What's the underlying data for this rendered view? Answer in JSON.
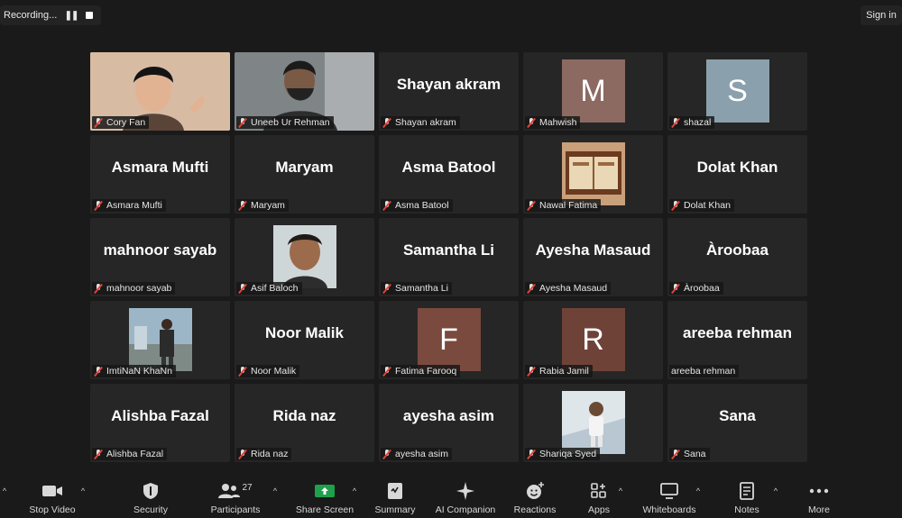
{
  "top_bar": {
    "recording_label": "Recording...",
    "pause_glyph": "❚❚",
    "sign_in_label": "Sign in"
  },
  "participants": [
    {
      "caption": "Cory Fan",
      "type": "video",
      "active": true
    },
    {
      "caption": "Uneeb Ur Rehman",
      "type": "video"
    },
    {
      "caption": "Shayan akram",
      "type": "name",
      "display": "Shayan akram"
    },
    {
      "caption": "Mahwish",
      "type": "avatar",
      "letter": "M",
      "color": "#8c6a62"
    },
    {
      "caption": "shazal",
      "type": "avatar",
      "letter": "S",
      "color": "#8aa0ac"
    },
    {
      "caption": "Asmara Mufti",
      "type": "name",
      "display": "Asmara Mufti"
    },
    {
      "caption": "Maryam",
      "type": "name",
      "display": "Maryam"
    },
    {
      "caption": "Asma Batool",
      "type": "name",
      "display": "Asma Batool"
    },
    {
      "caption": "Nawal Fatima",
      "type": "photo",
      "icon": "book-photo"
    },
    {
      "caption": "Dolat Khan",
      "type": "name",
      "display": "Dolat Khan"
    },
    {
      "caption": "mahnoor sayab",
      "type": "name",
      "display": "mahnoor sayab"
    },
    {
      "caption": "Asif Baloch",
      "type": "photo",
      "icon": "portrait-photo"
    },
    {
      "caption": "Samantha Li",
      "type": "name",
      "display": "Samantha Li"
    },
    {
      "caption": "Ayesha Masaud",
      "type": "name",
      "display": "Ayesha Masaud"
    },
    {
      "caption": "Àroobaa",
      "type": "name",
      "display": "Àroobaa"
    },
    {
      "caption": "ImtiNaN KhaNn",
      "type": "photo",
      "icon": "outdoor-photo"
    },
    {
      "caption": "Noor Malik",
      "type": "name",
      "display": "Noor Malik"
    },
    {
      "caption": "Fatima Farooq",
      "type": "avatar",
      "letter": "F",
      "color": "#7a4a3f"
    },
    {
      "caption": "Rabia Jamil",
      "type": "avatar",
      "letter": "R",
      "color": "#6f4238"
    },
    {
      "caption": "areeba rehman",
      "type": "name",
      "display": "areeba rehman",
      "unmuted": true
    },
    {
      "caption": "Alishba Fazal",
      "type": "name",
      "display": "Alishba Fazal"
    },
    {
      "caption": "Rida naz",
      "type": "name",
      "display": "Rida naz"
    },
    {
      "caption": "ayesha asim",
      "type": "name",
      "display": "ayesha asim"
    },
    {
      "caption": "Shariqa Syed",
      "type": "photo",
      "icon": "child-photo"
    },
    {
      "caption": "Sana",
      "type": "name",
      "display": "Sana"
    }
  ],
  "toolbar": {
    "stop_video": "Stop Video",
    "security": "Security",
    "participants": "Participants",
    "participants_count": "27",
    "share_screen": "Share Screen",
    "summary": "Summary",
    "ai_companion": "AI Companion",
    "reactions": "Reactions",
    "apps": "Apps",
    "whiteboards": "Whiteboards",
    "notes": "Notes",
    "more": "More",
    "share_color": "#1fa04a"
  }
}
